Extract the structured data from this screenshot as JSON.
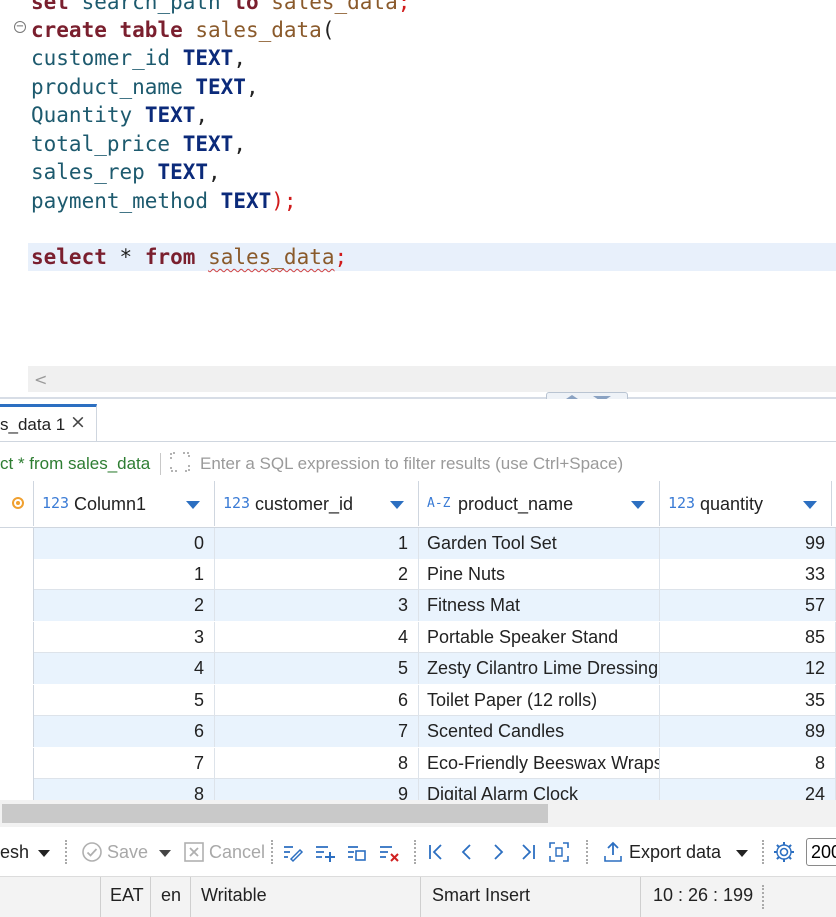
{
  "editor": {
    "lines": [
      {
        "kw1": "set",
        "id": "search_path",
        "kw2": "to",
        "tbl": "sales_data",
        "end": ";"
      },
      {
        "kw1": "create",
        "kw2": "table",
        "tbl": "sales_data",
        "end": "("
      },
      {
        "col": "customer_id",
        "type": "TEXT",
        "end": ","
      },
      {
        "col": "product_name",
        "type": "TEXT",
        "end": ","
      },
      {
        "col": "Quantity",
        "type": "TEXT",
        "end": ","
      },
      {
        "col": "total_price",
        "type": "TEXT",
        "end": ","
      },
      {
        "col": "sales_rep",
        "type": "TEXT",
        "end": ","
      },
      {
        "col": "payment_method",
        "type": "TEXT",
        "end": ");"
      },
      {
        "kw1": "select",
        "star": "*",
        "kw2": "from",
        "tbl": "sales_data",
        "end": ";"
      }
    ],
    "fold_icon": "minus-circle-icon"
  },
  "result_tab": {
    "label": "s_data 1",
    "close": "×"
  },
  "filter": {
    "query": "ct * from sales_data",
    "placeholder": "Enter a SQL expression to filter results (use Ctrl+Space)"
  },
  "grid": {
    "columns": [
      {
        "type": "123",
        "name": "Column1"
      },
      {
        "type": "123",
        "name": "customer_id"
      },
      {
        "type": "A-Z",
        "name": "product_name"
      },
      {
        "type": "123",
        "name": "quantity"
      }
    ],
    "rows": [
      {
        "c1": "0",
        "cid": "1",
        "product": "Garden Tool Set",
        "qty": "99"
      },
      {
        "c1": "1",
        "cid": "2",
        "product": "Pine Nuts",
        "qty": "33"
      },
      {
        "c1": "2",
        "cid": "3",
        "product": "Fitness Mat",
        "qty": "57"
      },
      {
        "c1": "3",
        "cid": "4",
        "product": "Portable Speaker Stand",
        "qty": "85"
      },
      {
        "c1": "4",
        "cid": "5",
        "product": "Zesty Cilantro Lime Dressing",
        "qty": "12"
      },
      {
        "c1": "5",
        "cid": "6",
        "product": "Toilet Paper (12 rolls)",
        "qty": "35"
      },
      {
        "c1": "6",
        "cid": "7",
        "product": "Scented Candles",
        "qty": "89"
      },
      {
        "c1": "7",
        "cid": "8",
        "product": "Eco-Friendly Beeswax Wraps",
        "qty": "8"
      },
      {
        "c1": "8",
        "cid": "9",
        "product": "Digital Alarm Clock",
        "qty": "24"
      }
    ]
  },
  "toolbar": {
    "refresh_label": "esh",
    "save_label": "Save",
    "cancel_label": "Cancel",
    "export_label": "Export data",
    "page_size": "200"
  },
  "status": {
    "timezone": "EAT",
    "locale": "en",
    "mode": "Writable",
    "insert_mode": "Smart Insert",
    "cursor": "10 : 26 : 199"
  },
  "colors": {
    "accent": "#2c6fc1",
    "row_alt": "#e9f3fd",
    "filter_query": "#2e7d32",
    "keyword": "#7a1f2e",
    "type": "#0b2a7a"
  }
}
